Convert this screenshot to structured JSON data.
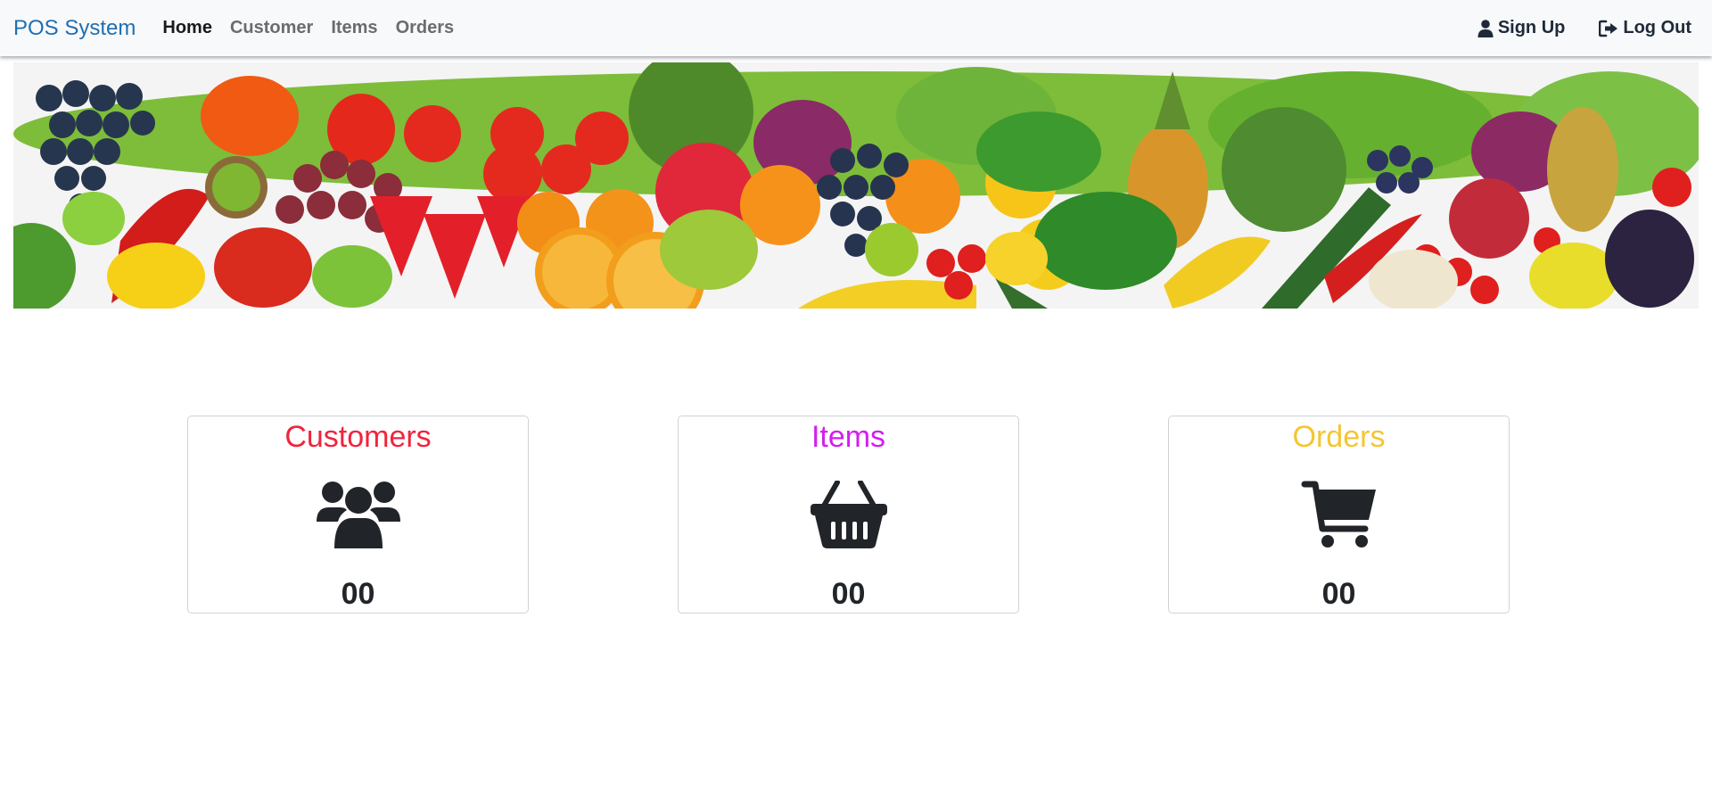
{
  "navbar": {
    "brand": "POS System",
    "links": [
      {
        "label": "Home",
        "active": true
      },
      {
        "label": "Customer",
        "active": false
      },
      {
        "label": "Items",
        "active": false
      },
      {
        "label": "Orders",
        "active": false
      }
    ],
    "signup_label": "Sign Up",
    "logout_label": "Log Out",
    "signup_icon": "user-icon",
    "logout_icon": "sign-out-icon"
  },
  "banner": {
    "subject": "fruits-and-vegetables-banner"
  },
  "cards": [
    {
      "title": "Customers",
      "color": "#f0243c",
      "icon": "users-icon",
      "count": "00"
    },
    {
      "title": "Items",
      "color": "#d21ef0",
      "icon": "basket-icon",
      "count": "00"
    },
    {
      "title": "Orders",
      "color": "#f5c531",
      "icon": "cart-icon",
      "count": "00"
    }
  ]
}
